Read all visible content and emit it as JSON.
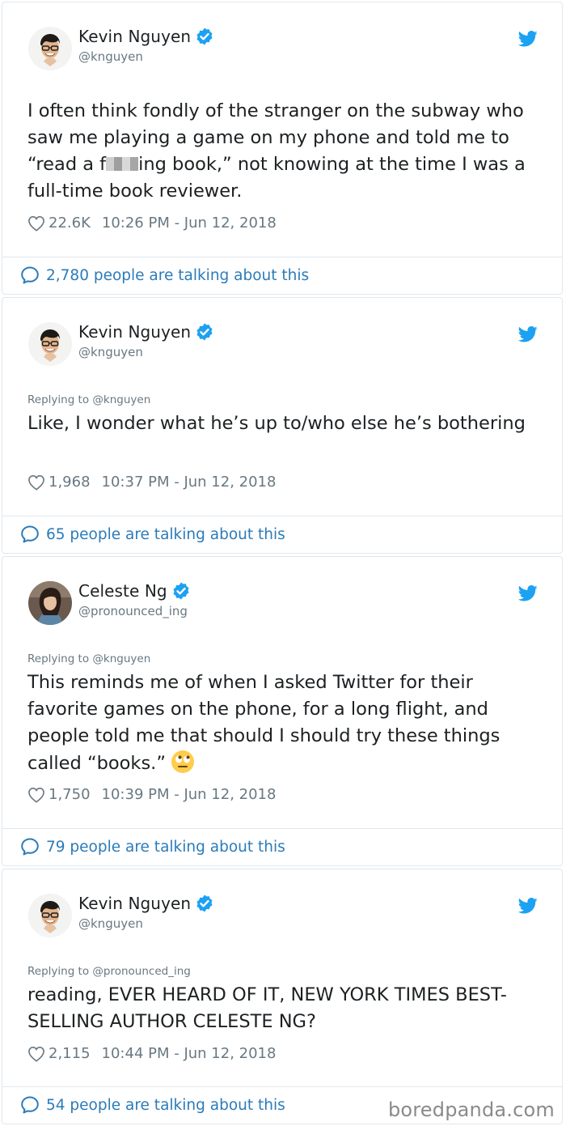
{
  "tweets": [
    {
      "name": "Kevin Nguyen",
      "handle": "@knguyen",
      "replying": "",
      "text_before": "I often think fondly of the stranger on the subway who saw me playing a game on my phone and told me to “read a f",
      "text_after": "ing book,” not knowing at the time I was a full-time book reviewer.",
      "likes": "22.6K",
      "timestamp": "10:26 PM - Jun 12, 2018",
      "talking": "2,780 people are talking about this"
    },
    {
      "name": "Kevin Nguyen",
      "handle": "@knguyen",
      "replying": "Replying to @knguyen",
      "text": "Like, I wonder what he’s up to/who else he’s bothering",
      "likes": "1,968",
      "timestamp": "10:37 PM - Jun 12, 2018",
      "talking": "65 people are talking about this"
    },
    {
      "name": "Celeste Ng",
      "handle": "@pronounced_ing",
      "replying": "Replying to @knguyen",
      "text": "This reminds me of when I asked Twitter for their favorite games on the phone, for a long flight, and people told me that should I should try these things called “books.”",
      "emoji": "face-with-rolling-eyes",
      "likes": "1,750",
      "timestamp": "10:39 PM - Jun 12, 2018",
      "talking": "79 people are talking about this"
    },
    {
      "name": "Kevin Nguyen",
      "handle": "@knguyen",
      "replying": "Replying to @pronounced_ing",
      "text": "reading, EVER HEARD OF IT, NEW YORK TIMES BEST-SELLING AUTHOR CELESTE NG?",
      "likes": "2,115",
      "timestamp": "10:44 PM - Jun 12, 2018",
      "talking": "54 people are talking about this"
    }
  ],
  "watermark": "boredpanda.com",
  "colors": {
    "twitter_blue": "#1da1f2",
    "link_blue": "#2b7bb9",
    "muted_gray": "#697882",
    "border": "#e1e8ed"
  },
  "icons": [
    "verified-badge-icon",
    "twitter-bird-icon",
    "heart-icon",
    "speech-bubble-icon"
  ]
}
